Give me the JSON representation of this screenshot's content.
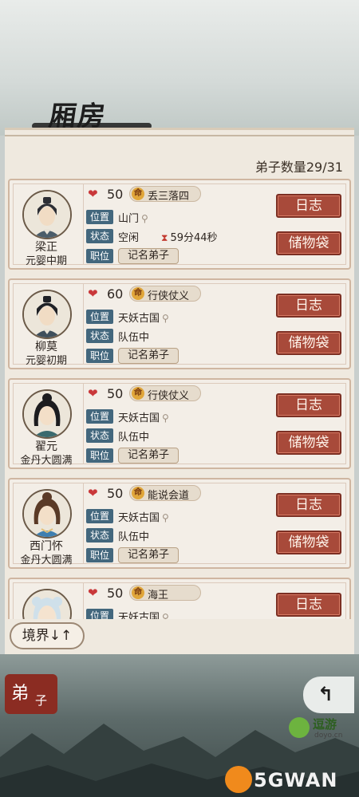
{
  "header": {
    "title": "厢房",
    "disciple_count": "弟子数量29/31"
  },
  "disciples": [
    {
      "name": "梁正",
      "realm": "元婴中期",
      "hp": "50",
      "fate": "丢三落四",
      "location": "山门",
      "status": "空闲",
      "timer": "59分44秒",
      "rank": "记名弟子"
    },
    {
      "name": "柳莫",
      "realm": "元婴初期",
      "hp": "60",
      "fate": "行侠仗义",
      "location": "天妖古国",
      "status": "队伍中",
      "rank": "记名弟子"
    },
    {
      "name": "翟元",
      "realm": "金丹大圆满",
      "hp": "50",
      "fate": "行侠仗义",
      "location": "天妖古国",
      "status": "队伍中",
      "rank": "记名弟子"
    },
    {
      "name": "西门怀",
      "realm": "金丹大圆满",
      "hp": "50",
      "fate": "能说会道",
      "location": "天妖古国",
      "status": "队伍中",
      "rank": "记名弟子"
    },
    {
      "name": "",
      "realm": "",
      "hp": "50",
      "fate": "海王",
      "location": "天妖古国",
      "status": "",
      "rank": ""
    }
  ],
  "labels": {
    "location": "位置",
    "status": "状态",
    "rank": "职位",
    "fate_icon": "命"
  },
  "buttons": {
    "log": "日志",
    "bag": "储物袋",
    "sort": "境界↓↑"
  },
  "bottom": {
    "tab_char1": "弟",
    "tab_char2": "子",
    "back_glyph": "↰"
  },
  "branding": {
    "doyo_name": "逗游",
    "doyo_url": "doyo.cn",
    "watermark": "5GWAN"
  },
  "icons": {
    "heart": "heart-icon",
    "pin": "location-pin-icon",
    "hourglass": "hourglass-icon"
  },
  "colors": {
    "button_red": "#a84a3a",
    "label_blue": "#43677d",
    "heart_red": "#c9383a"
  }
}
